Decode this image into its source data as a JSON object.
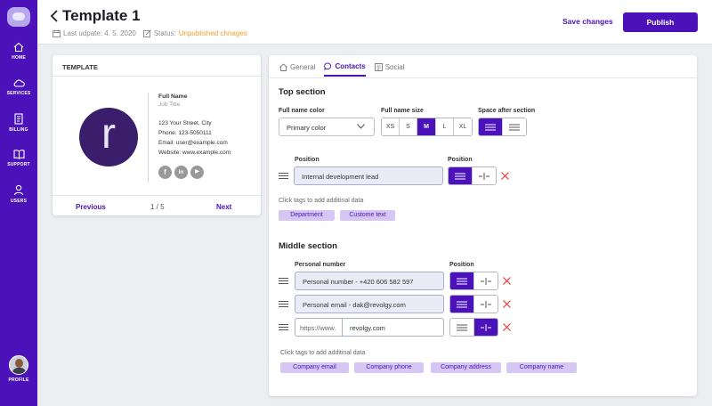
{
  "sidebar": {
    "items": [
      {
        "label": "HOME",
        "icon": "home-icon"
      },
      {
        "label": "SERVICES",
        "icon": "cloud-icon"
      },
      {
        "label": "BILLING",
        "icon": "billing-icon"
      },
      {
        "label": "SUPPORT",
        "icon": "book-icon"
      },
      {
        "label": "USERS",
        "icon": "user-icon"
      }
    ],
    "profile_label": "PROFILE"
  },
  "header": {
    "title": "Template 1",
    "last_update_label": "Last udpate: 4. 5. 2020",
    "status_label": "Status:",
    "status_value": "Unpublished chnages",
    "save_label": "Save changes",
    "publish_label": "Publish"
  },
  "template_card": {
    "title": "TEMPLATE",
    "avatar_letter": "r",
    "full_name": "Full Name",
    "job_title": "Job Title",
    "address": "123 Your Street, City",
    "phone": "Phone: 123-5050111",
    "email": "Email: user@example.com",
    "website": "Website: www.example.com",
    "socials": [
      "f",
      "in",
      "▶"
    ],
    "prev_label": "Previous",
    "pager": "1 / 5",
    "next_label": "Next"
  },
  "tabs": [
    {
      "label": "General",
      "icon": "home-icon"
    },
    {
      "label": "Contacts",
      "icon": "chat-icon",
      "active": true
    },
    {
      "label": "Social",
      "icon": "social-icon"
    }
  ],
  "top_section": {
    "title": "Top section",
    "full_name_color_label": "Full name color",
    "full_name_color_value": "Primary color",
    "full_name_size_label": "Full name size",
    "sizes": [
      "XS",
      "S",
      "M",
      "L",
      "XL"
    ],
    "selected_size": "M",
    "space_after_label": "Space after section",
    "field_label": "Position",
    "field_value": "Internal development lead",
    "position_label": "Position",
    "hint": "Click tags to add additinal data",
    "tags": [
      "Department",
      "Custome text"
    ]
  },
  "middle_section": {
    "title": "Middle  section",
    "field_label": "Personal number",
    "position_label": "Position",
    "rows": [
      {
        "value": "Personal number - +420 606 582 597"
      },
      {
        "value": "Personal email - dak@revolgy.com"
      },
      {
        "prefix": "https://www.",
        "value": "revolgy.com"
      }
    ],
    "hint": "Click tags to add additinal data",
    "tags": [
      "Company email",
      "Company phone",
      "Company address",
      "Company name"
    ]
  },
  "colors": {
    "accent": "#4a12b8",
    "status_orange": "#f0a133",
    "tag_bg": "#d6c6f4",
    "danger": "#e53935"
  }
}
